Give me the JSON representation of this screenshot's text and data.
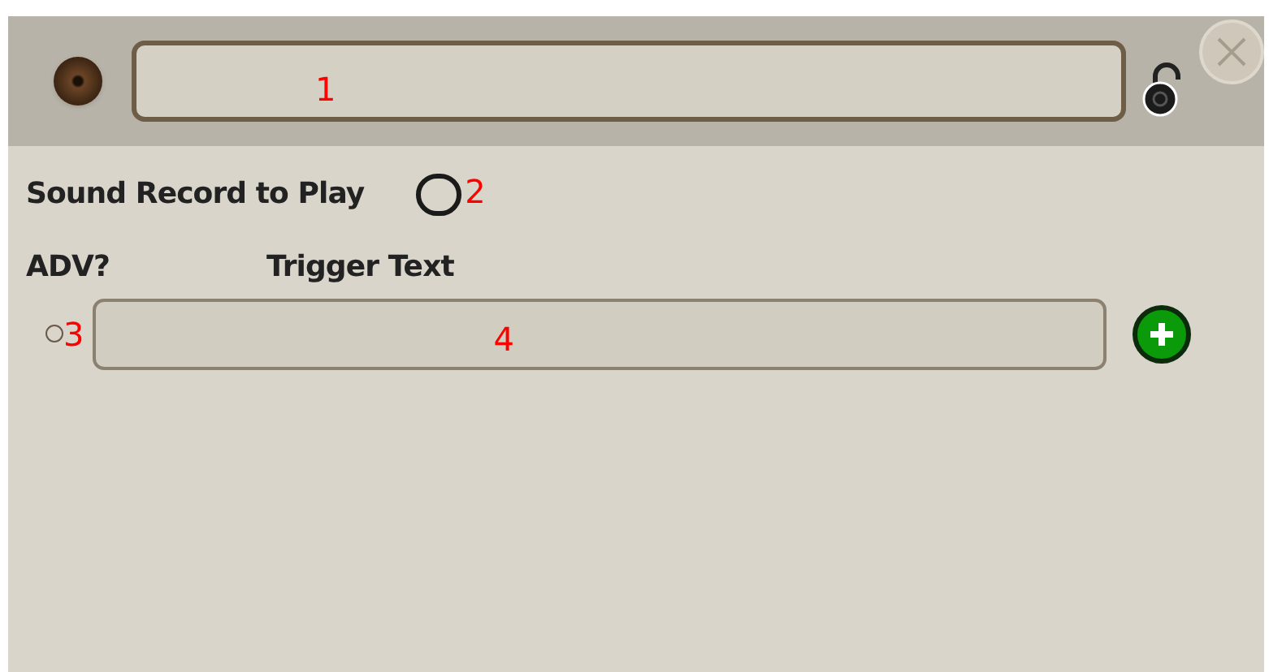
{
  "header": {
    "name_field": {
      "annotation": "1"
    }
  },
  "sound_record": {
    "label": "Sound Record to Play",
    "checked": false,
    "annotation": "2"
  },
  "triggers": {
    "columns": [
      "ADV?",
      "Trigger Text"
    ],
    "rows": [
      {
        "adv_checked": false,
        "adv_annotation": "3",
        "text_annotation": "4"
      }
    ]
  }
}
